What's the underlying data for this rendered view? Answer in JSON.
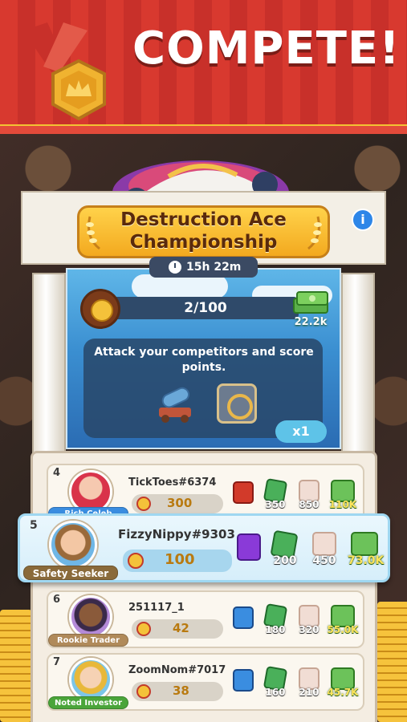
{
  "header": {
    "title": "COMPETE!"
  },
  "event": {
    "name_line1": "Destruction Ace",
    "name_line2": "Championship",
    "info_icon": "i",
    "timer": "15h 22m",
    "progress": "2/100",
    "progress_value": 0.02,
    "reward": "22.2k",
    "task": "Attack your competitors and score points.",
    "multiplier": "x1"
  },
  "leaderboard": [
    {
      "rank": "4",
      "name": "TickToes#6374",
      "title": "Rich Celeb",
      "tag_color": "#3a8de0",
      "score": "300",
      "pack": "red",
      "cards": "350",
      "dice": "850",
      "cash": "110K"
    },
    {
      "rank": "5",
      "name": "FizzyNippy#9303",
      "title": "Safety Seeker",
      "tag_color": "#8a6a3a",
      "score": "100",
      "pack": "purple",
      "cards": "200",
      "dice": "450",
      "cash": "73.0K",
      "highlight": true
    },
    {
      "rank": "6",
      "name": "251117_1",
      "title": "Rookie Trader",
      "tag_color": "#b08a5a",
      "score": "42",
      "pack": "blue",
      "cards": "180",
      "dice": "320",
      "cash": "55.0K"
    },
    {
      "rank": "7",
      "name": "ZoomNom#7017",
      "title": "Noted Investor",
      "tag_color": "#4aa53a",
      "score": "38",
      "pack": "blue",
      "cards": "160",
      "dice": "210",
      "cash": "45.7K"
    }
  ],
  "colors": {
    "banner": "#d8392f",
    "accent_gold": "#f3a91f",
    "highlight": "#9fd7f1"
  }
}
